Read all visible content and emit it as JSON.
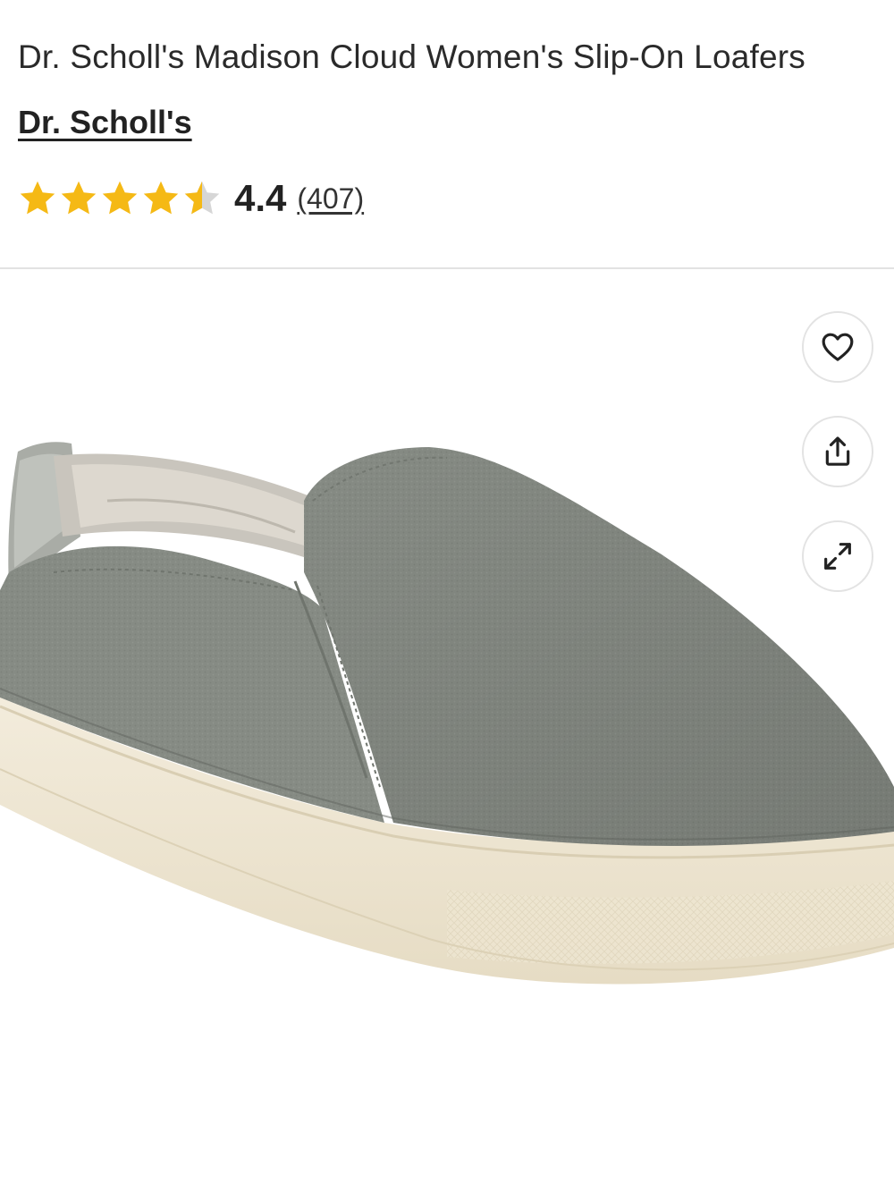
{
  "product": {
    "title": "Dr. Scholl's Madison Cloud Women's Slip-On Loafers",
    "brand": "Dr. Scholl's",
    "rating": "4.4",
    "rating_value": 4.4,
    "rating_max": 5,
    "review_count": "(407)"
  },
  "actions": {
    "favorite_icon": "heart-icon",
    "share_icon": "share-icon",
    "expand_icon": "expand-icon"
  },
  "colors": {
    "star_filled": "#f5b915",
    "star_empty": "#d6d6d6",
    "shoe_upper": "#868b84",
    "shoe_sole": "#efe7d4"
  }
}
